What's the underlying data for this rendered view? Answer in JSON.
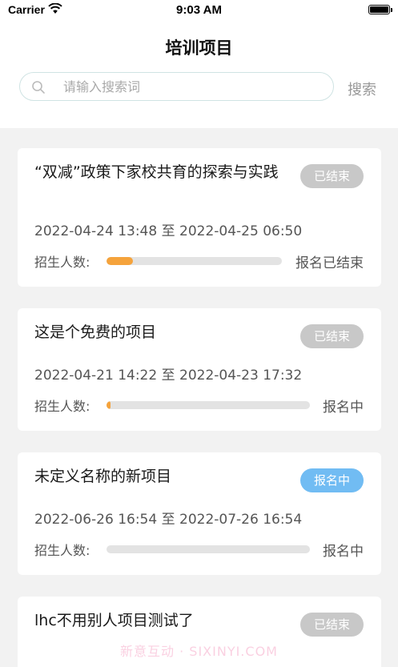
{
  "status_bar": {
    "carrier": "Carrier",
    "time": "9:03 AM"
  },
  "header": {
    "title": "培训项目"
  },
  "search": {
    "placeholder": "请输入搜索词",
    "value": "",
    "button_label": "搜索"
  },
  "projects": [
    {
      "title": "“双减”政策下家校共育的探索与实践",
      "status_badge": "已结束",
      "dates": "2022-04-24 13:48 至 2022-04-25 06:50",
      "enroll_label": "招生人数:",
      "enroll_progress": 0.15,
      "enroll_status": "报名已结束"
    },
    {
      "title": "这是个免费的项目",
      "status_badge": "已结束",
      "dates": "2022-04-21 14:22 至 2022-04-23 17:32",
      "enroll_label": "招生人数:",
      "enroll_progress": 0.02,
      "enroll_status": "报名中"
    },
    {
      "title": "未定义名称的新项目",
      "status_badge": "报名中",
      "dates": "2022-06-26 16:54 至 2022-07-26 16:54",
      "enroll_label": "招生人数:",
      "enroll_progress": 0,
      "enroll_status": "报名中"
    },
    {
      "title": "lhc不用别人项目测试了",
      "status_badge": "已结束"
    }
  ],
  "colors": {
    "accent_orange": "#f5a33c",
    "badge_open": "#71bcf3",
    "badge_ended": "#c8c8c8"
  },
  "watermark": "新意互动 · SIXINYI.COM"
}
